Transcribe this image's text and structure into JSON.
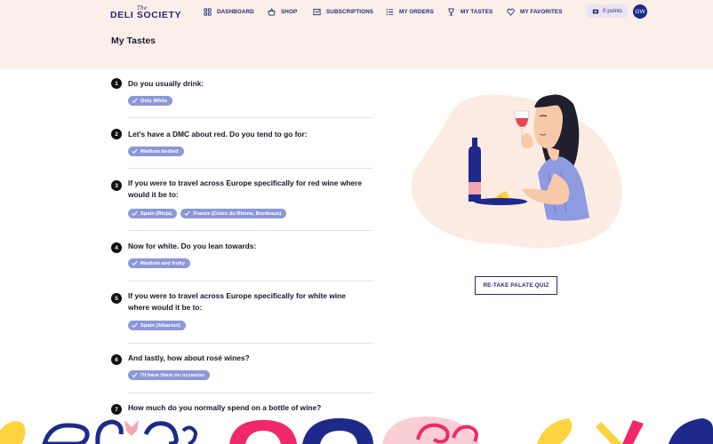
{
  "header": {
    "logo_the": "The",
    "logo_text": "DELI SOCIETY",
    "nav": [
      {
        "label": "DASHBOARD",
        "icon": "grid-icon"
      },
      {
        "label": "SHOP",
        "icon": "basket-icon"
      },
      {
        "label": "SUBSCRIPTIONS",
        "icon": "subscription-icon"
      },
      {
        "label": "MY ORDERS",
        "icon": "list-icon"
      },
      {
        "label": "MY TASTES",
        "icon": "glass-icon"
      },
      {
        "label": "MY FAVORITES",
        "icon": "heart-icon"
      }
    ],
    "points": "0 points",
    "avatar_initials": "GW"
  },
  "page": {
    "title": "My Tastes"
  },
  "questions": [
    {
      "number": "1",
      "text": "Do you usually drink:",
      "answers": [
        "Only White"
      ]
    },
    {
      "number": "2",
      "text": "Let's have a DMC about red. Do you tend to go for:",
      "answers": [
        "Medium bodied"
      ]
    },
    {
      "number": "3",
      "text": "If you were to travel across Europe specifically for red wine where would it be to:",
      "answers": [
        "Spain (Rioja)",
        "France (Cotes du Rhone, Bordeaux)"
      ]
    },
    {
      "number": "4",
      "text": "Now for white. Do you lean towards:",
      "answers": [
        "Medium and fruity"
      ]
    },
    {
      "number": "5",
      "text": "If you were to travel across Europe specifically for white wine where would it be to:",
      "answers": [
        "Spain (Albarino)"
      ]
    },
    {
      "number": "6",
      "text": "And lastly, how about rosé wines?",
      "answers": [
        "I'll have them on occasion"
      ]
    },
    {
      "number": "7",
      "text": "How much do you normally spend on a bottle of wine?",
      "answers": []
    }
  ],
  "retake_label": "RE-TAKE PALATE QUIZ",
  "colors": {
    "header_bg": "#fcefe9",
    "navy": "#23297a",
    "chip": "#8b98d8",
    "blob": "#fcebe3",
    "footer_yellow": "#ffd23f",
    "footer_pink": "#f0286a",
    "footer_blue": "#1d2a8a"
  }
}
